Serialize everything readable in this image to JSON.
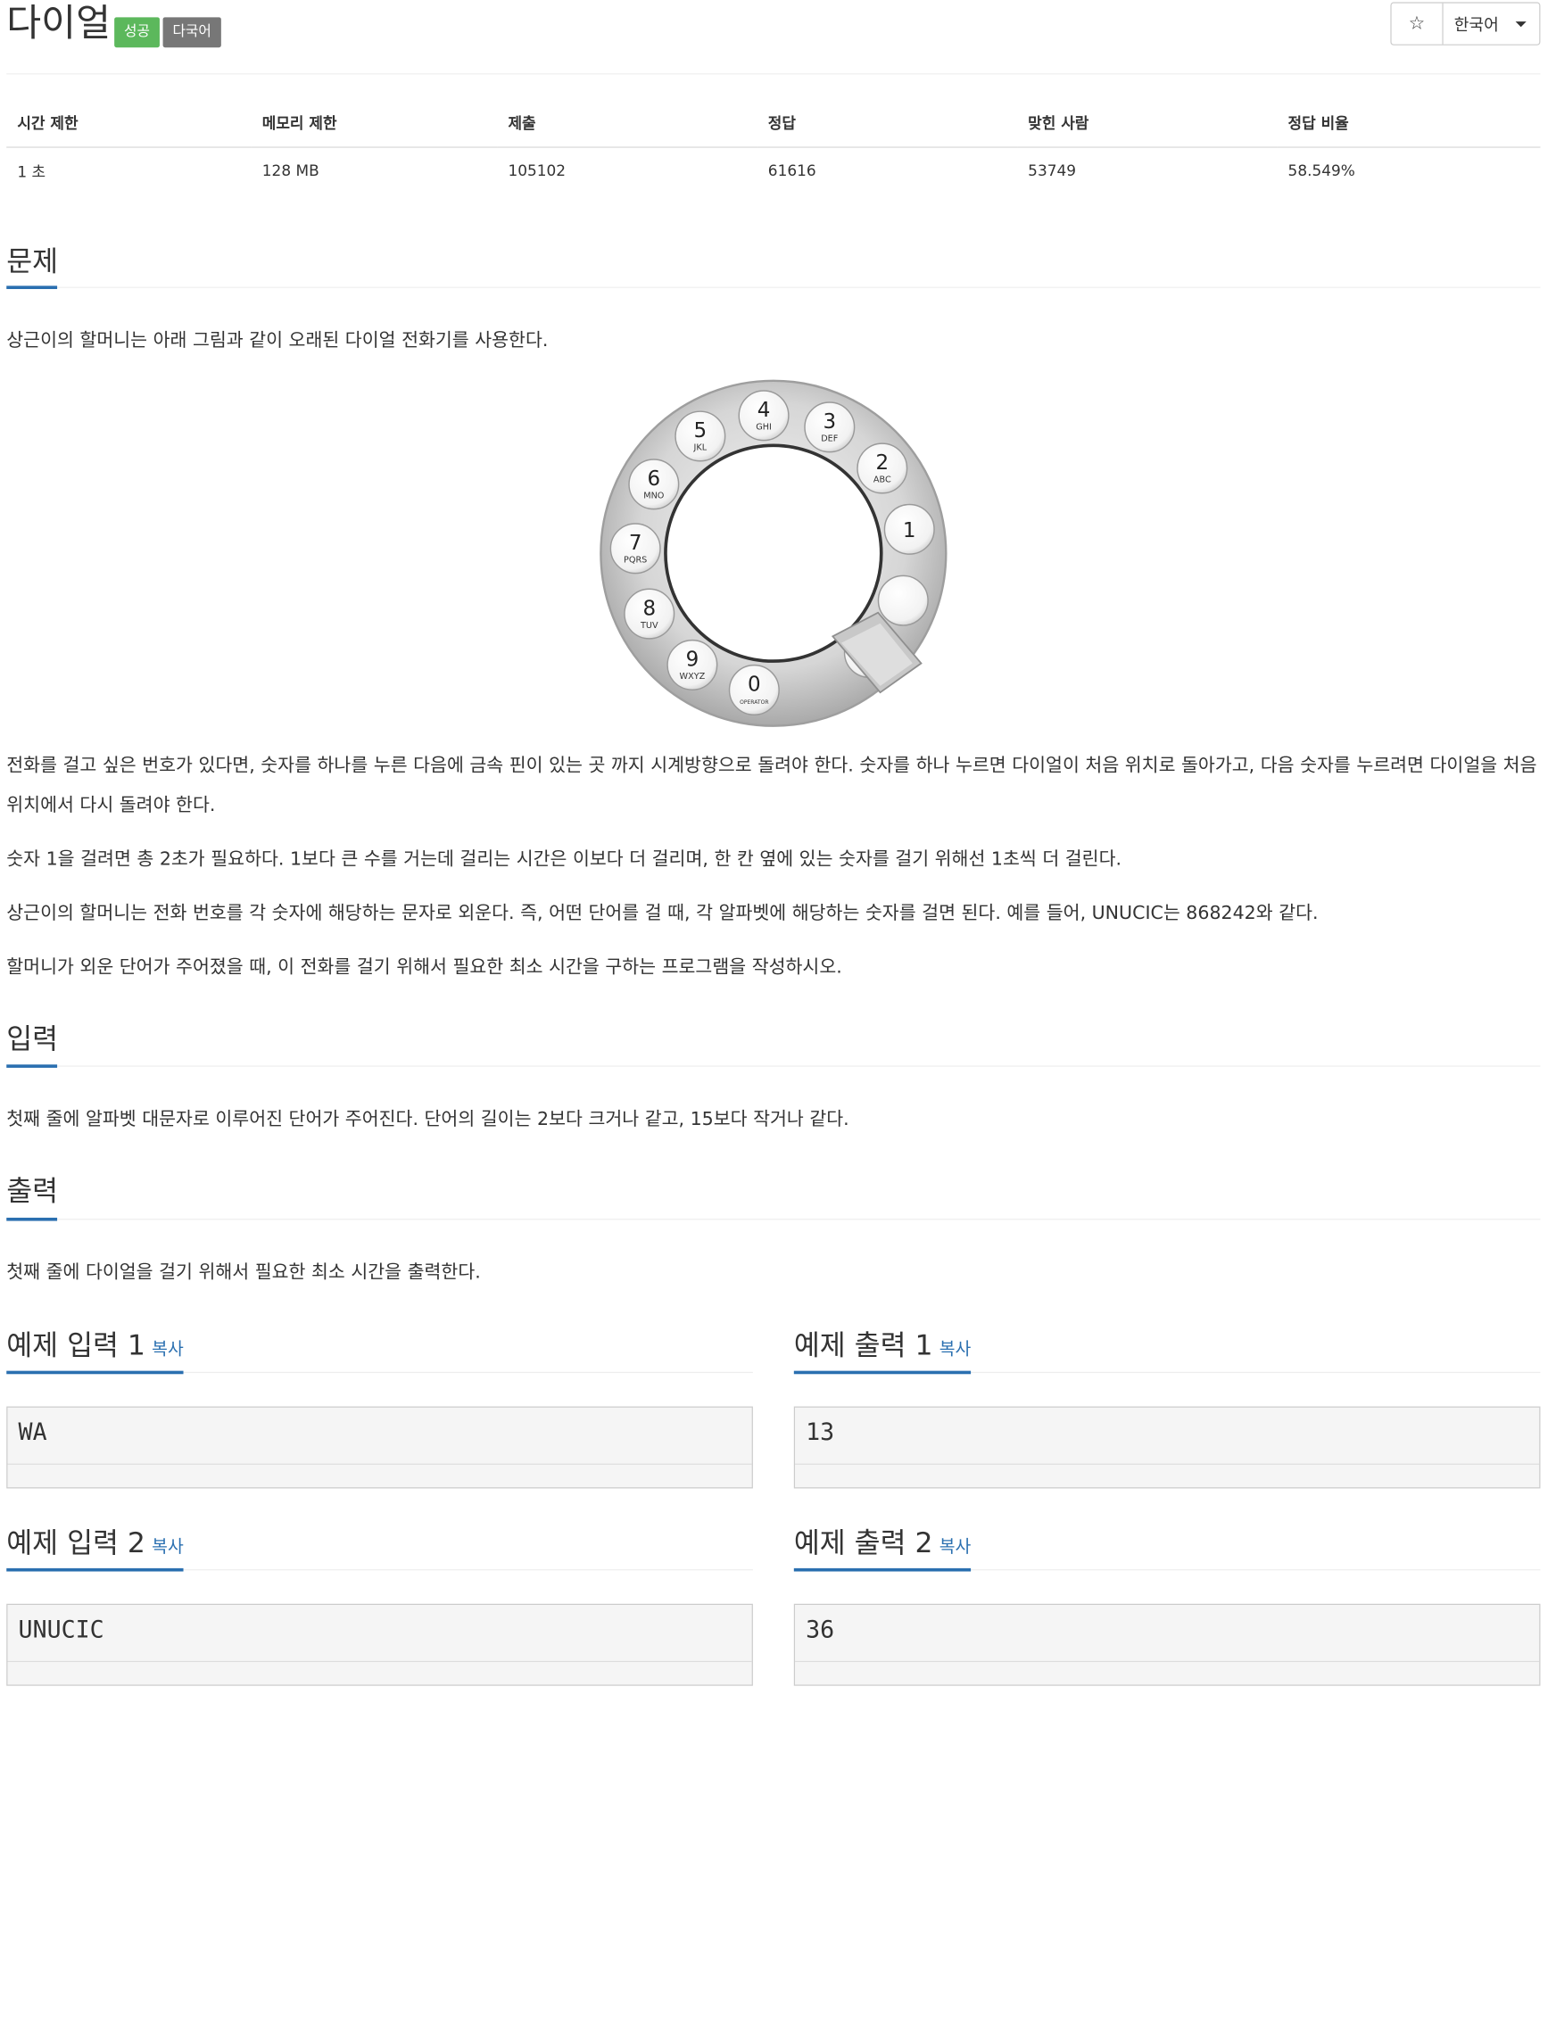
{
  "header": {
    "title": "다이얼",
    "badges": [
      "성공",
      "다국어"
    ],
    "star_icon": "☆",
    "language": "한국어"
  },
  "info_table": {
    "headers": [
      "시간 제한",
      "메모리 제한",
      "제출",
      "정답",
      "맞힌 사람",
      "정답 비율"
    ],
    "values": [
      "1 초",
      "128 MB",
      "105102",
      "61616",
      "53749",
      "58.549%"
    ]
  },
  "sections": {
    "problem_title": "문제",
    "problem_paragraphs": [
      "상근이의 할머니는 아래 그림과 같이 오래된 다이얼 전화기를 사용한다.",
      "전화를 걸고 싶은 번호가 있다면, 숫자를 하나를 누른 다음에 금속 핀이 있는 곳 까지 시계방향으로 돌려야 한다. 숫자를 하나 누르면 다이얼이 처음 위치로 돌아가고, 다음 숫자를 누르려면 다이얼을 처음 위치에서 다시 돌려야 한다.",
      "숫자 1을 걸려면 총 2초가 필요하다. 1보다 큰 수를 거는데 걸리는 시간은 이보다 더 걸리며, 한 칸 옆에 있는 숫자를 걸기 위해선 1초씩 더 걸린다.",
      "상근이의 할머니는 전화 번호를 각 숫자에 해당하는 문자로 외운다. 즉, 어떤 단어를 걸 때, 각 알파벳에 해당하는 숫자를 걸면 된다. 예를 들어, UNUCIC는 868242와 같다.",
      "할머니가 외운 단어가 주어졌을 때, 이 전화를 걸기 위해서 필요한 최소 시간을 구하는 프로그램을 작성하시오."
    ],
    "input_title": "입력",
    "input_text": "첫째 줄에 알파벳 대문자로 이루어진 단어가 주어진다. 단어의 길이는 2보다 크거나 같고, 15보다 작거나 같다.",
    "output_title": "출력",
    "output_text": "첫째 줄에 다이얼을 걸기 위해서 필요한 최소 시간을 출력한다."
  },
  "dial": {
    "keys": [
      {
        "num": "1",
        "letters": ""
      },
      {
        "num": "2",
        "letters": "ABC"
      },
      {
        "num": "3",
        "letters": "DEF"
      },
      {
        "num": "4",
        "letters": "GHI"
      },
      {
        "num": "5",
        "letters": "JKL"
      },
      {
        "num": "6",
        "letters": "MNO"
      },
      {
        "num": "7",
        "letters": "PQRS"
      },
      {
        "num": "8",
        "letters": "TUV"
      },
      {
        "num": "9",
        "letters": "WXYZ"
      },
      {
        "num": "0",
        "letters": "OPERATOR"
      }
    ]
  },
  "samples": {
    "copy_label": "복사",
    "in1_title": "예제 입력 1",
    "out1_title": "예제 출력 1",
    "in2_title": "예제 입력 2",
    "out2_title": "예제 출력 2",
    "in1": "WA",
    "out1": "13",
    "in2": "UNUCIC",
    "out2": "36"
  }
}
